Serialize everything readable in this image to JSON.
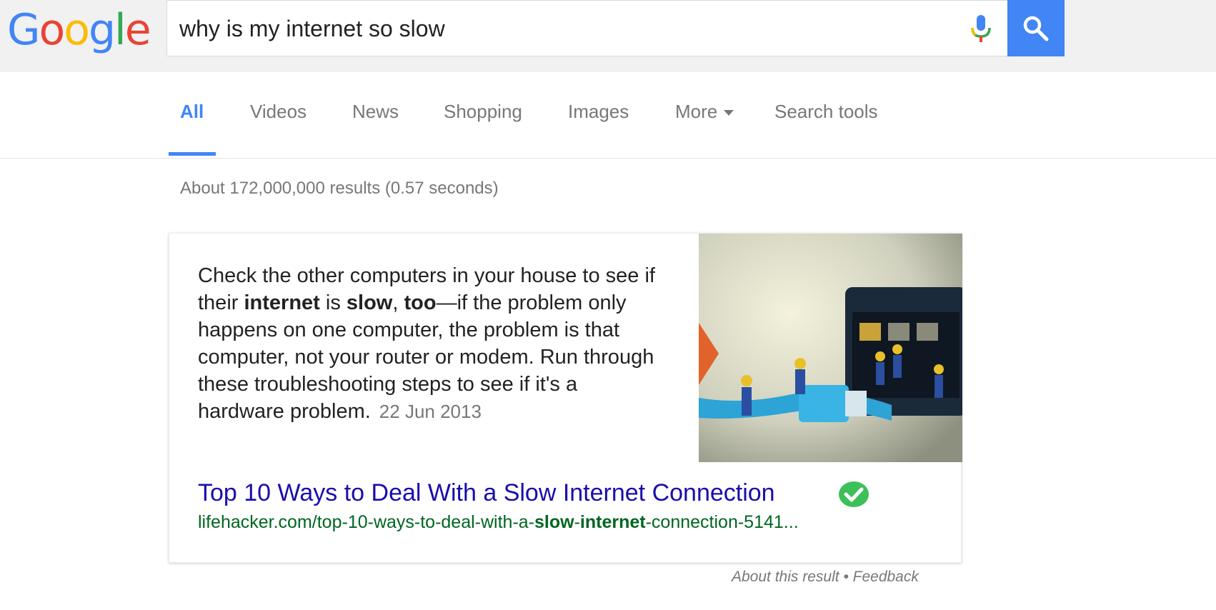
{
  "logo": {
    "letters": [
      "G",
      "o",
      "o",
      "g",
      "l",
      "e"
    ],
    "colors": [
      "#4285f4",
      "#ea4335",
      "#fbbc05",
      "#4285f4",
      "#34a853",
      "#ea4335"
    ]
  },
  "search": {
    "query": "why is my internet so slow",
    "mic_icon": "microphone-icon",
    "button_icon": "search-icon",
    "accent": "#4285f4"
  },
  "tabs": [
    {
      "label": "All",
      "active": true
    },
    {
      "label": "Videos"
    },
    {
      "label": "News"
    },
    {
      "label": "Shopping"
    },
    {
      "label": "Images"
    },
    {
      "label": "More"
    },
    {
      "label": "Search tools"
    }
  ],
  "result_stats": "About 172,000,000 results (0.57 seconds)",
  "featured_snippet": {
    "text_parts": [
      "Check the other computers in your house to see if their ",
      "internet",
      " is ",
      "slow",
      ", ",
      "too",
      "—if the problem only happens on one computer, the problem is that computer, not your router or modem. Run through these troubleshooting steps to see if it's a hardware problem."
    ],
    "date": "22 Jun 2013",
    "title": "Top 10 Ways to Deal With a Slow Internet Connection",
    "verified_icon": "check-circle-icon",
    "url_parts": [
      "lifehacker.com/top-10-ways-to-deal-with-a-",
      "slow",
      "-",
      "internet",
      "-connection-5141..."
    ]
  },
  "footer": {
    "about": "About this result",
    "separator": "•",
    "feedback": "Feedback"
  }
}
